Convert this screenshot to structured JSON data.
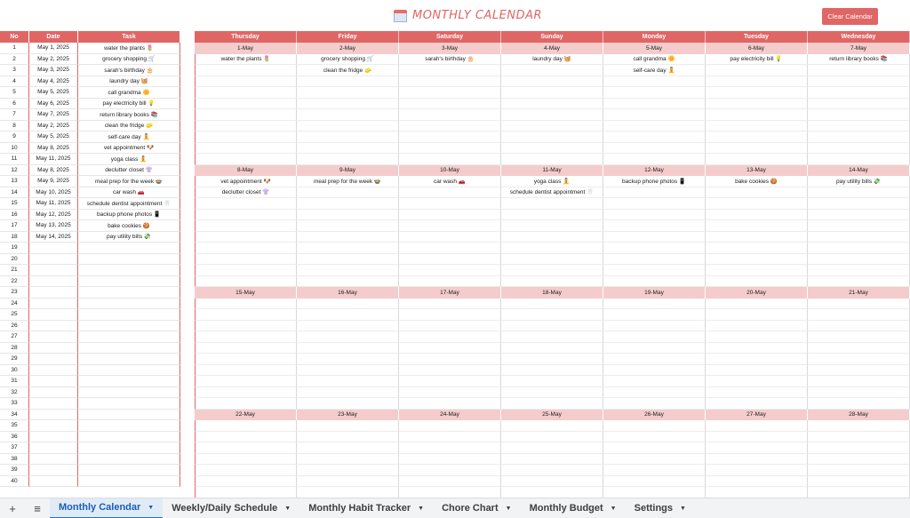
{
  "header": {
    "title": "MONTHLY CALENDAR",
    "clear_button": "Clear Calendar"
  },
  "list": {
    "headers": [
      "No",
      "Date",
      "Task"
    ],
    "rows": [
      {
        "no": "1",
        "date": "May 1, 2025",
        "task": "water the plants 🌷"
      },
      {
        "no": "2",
        "date": "May 2, 2025",
        "task": "grocery shopping 🛒"
      },
      {
        "no": "3",
        "date": "May 3, 2025",
        "task": "sarah's birthday 🎂"
      },
      {
        "no": "4",
        "date": "May 4, 2025",
        "task": "laundry day 🧺"
      },
      {
        "no": "5",
        "date": "May 5, 2025",
        "task": "call grandma 🌼"
      },
      {
        "no": "6",
        "date": "May 6, 2025",
        "task": "pay electricity bill 💡"
      },
      {
        "no": "7",
        "date": "May 7, 2025",
        "task": "return library books 📚"
      },
      {
        "no": "8",
        "date": "May 2, 2025",
        "task": "clean the fridge 🧽"
      },
      {
        "no": "9",
        "date": "May 5, 2025",
        "task": "self-care day 🧘"
      },
      {
        "no": "10",
        "date": "May 8, 2025",
        "task": "vet appointment 🐶"
      },
      {
        "no": "11",
        "date": "May 11, 2025",
        "task": "yoga class 🧘"
      },
      {
        "no": "12",
        "date": "May 8, 2025",
        "task": "declutter closet 👚"
      },
      {
        "no": "13",
        "date": "May 9, 2025",
        "task": "meal prep for the week 🍲"
      },
      {
        "no": "14",
        "date": "May 10, 2025",
        "task": "car wash 🚗"
      },
      {
        "no": "15",
        "date": "May 11, 2025",
        "task": "schedule dentist appointment 🦷"
      },
      {
        "no": "16",
        "date": "May 12, 2025",
        "task": "backup phone photos 📱"
      },
      {
        "no": "17",
        "date": "May 13, 2025",
        "task": "bake cookies 🍪"
      },
      {
        "no": "18",
        "date": "May 14, 2025",
        "task": "pay utility bills 💸"
      },
      {
        "no": "19",
        "date": "",
        "task": ""
      },
      {
        "no": "20",
        "date": "",
        "task": ""
      },
      {
        "no": "21",
        "date": "",
        "task": ""
      },
      {
        "no": "22",
        "date": "",
        "task": ""
      },
      {
        "no": "23",
        "date": "",
        "task": ""
      },
      {
        "no": "24",
        "date": "",
        "task": ""
      },
      {
        "no": "25",
        "date": "",
        "task": ""
      },
      {
        "no": "26",
        "date": "",
        "task": ""
      },
      {
        "no": "27",
        "date": "",
        "task": ""
      },
      {
        "no": "28",
        "date": "",
        "task": ""
      },
      {
        "no": "29",
        "date": "",
        "task": ""
      },
      {
        "no": "30",
        "date": "",
        "task": ""
      },
      {
        "no": "31",
        "date": "",
        "task": ""
      },
      {
        "no": "32",
        "date": "",
        "task": ""
      },
      {
        "no": "33",
        "date": "",
        "task": ""
      },
      {
        "no": "34",
        "date": "",
        "task": ""
      },
      {
        "no": "35",
        "date": "",
        "task": ""
      },
      {
        "no": "36",
        "date": "",
        "task": ""
      },
      {
        "no": "37",
        "date": "",
        "task": ""
      },
      {
        "no": "38",
        "date": "",
        "task": ""
      },
      {
        "no": "39",
        "date": "",
        "task": ""
      },
      {
        "no": "40",
        "date": "",
        "task": ""
      }
    ]
  },
  "calendar": {
    "day_headers": [
      "Thursday",
      "Friday",
      "Saturday",
      "Sunday",
      "Monday",
      "Tuesday",
      "Wednesday"
    ],
    "weeks": [
      {
        "dates": [
          "1-May",
          "2-May",
          "3-May",
          "4-May",
          "5-May",
          "6-May",
          "7-May"
        ],
        "tasks": [
          [
            "water the plants 🌷",
            "grocery shopping 🛒",
            "sarah's birthday 🎂",
            "laundry day 🧺",
            "call grandma 🌼",
            "pay electricity bill 💡",
            "return library books 📚"
          ],
          [
            "",
            "clean the fridge 🧽",
            "",
            "",
            "self-care day 🧘",
            "",
            ""
          ]
        ]
      },
      {
        "dates": [
          "8-May",
          "9-May",
          "10-May",
          "11-May",
          "12-May",
          "13-May",
          "14-May"
        ],
        "tasks": [
          [
            "vet appointment 🐶",
            "meal prep for the week 🍲",
            "car wash 🚗",
            "yoga class 🧘",
            "backup phone photos 📱",
            "bake cookies 🍪",
            "pay utility bills 💸"
          ],
          [
            "declutter closet 👚",
            "",
            "",
            "schedule dentist appointment 🦷",
            "",
            "",
            ""
          ]
        ]
      },
      {
        "dates": [
          "15-May",
          "16-May",
          "17-May",
          "18-May",
          "19-May",
          "20-May",
          "21-May"
        ],
        "tasks": []
      },
      {
        "dates": [
          "22-May",
          "23-May",
          "24-May",
          "25-May",
          "26-May",
          "27-May",
          "28-May"
        ],
        "tasks": []
      }
    ]
  },
  "tabs": [
    {
      "label": "Monthly Calendar",
      "active": true
    },
    {
      "label": "Weekly/Daily Schedule",
      "active": false
    },
    {
      "label": "Monthly Habit Tracker",
      "active": false
    },
    {
      "label": "Chore Chart",
      "active": false
    },
    {
      "label": "Monthly Budget",
      "active": false
    },
    {
      "label": "Settings",
      "active": false
    }
  ],
  "toolbar_icons": [
    "add-sheet-icon",
    "all-sheets-menu-icon"
  ],
  "colors": {
    "accent": "#e06666",
    "date_row": "#f4cccc",
    "active_tab": "#1a5fb4"
  }
}
